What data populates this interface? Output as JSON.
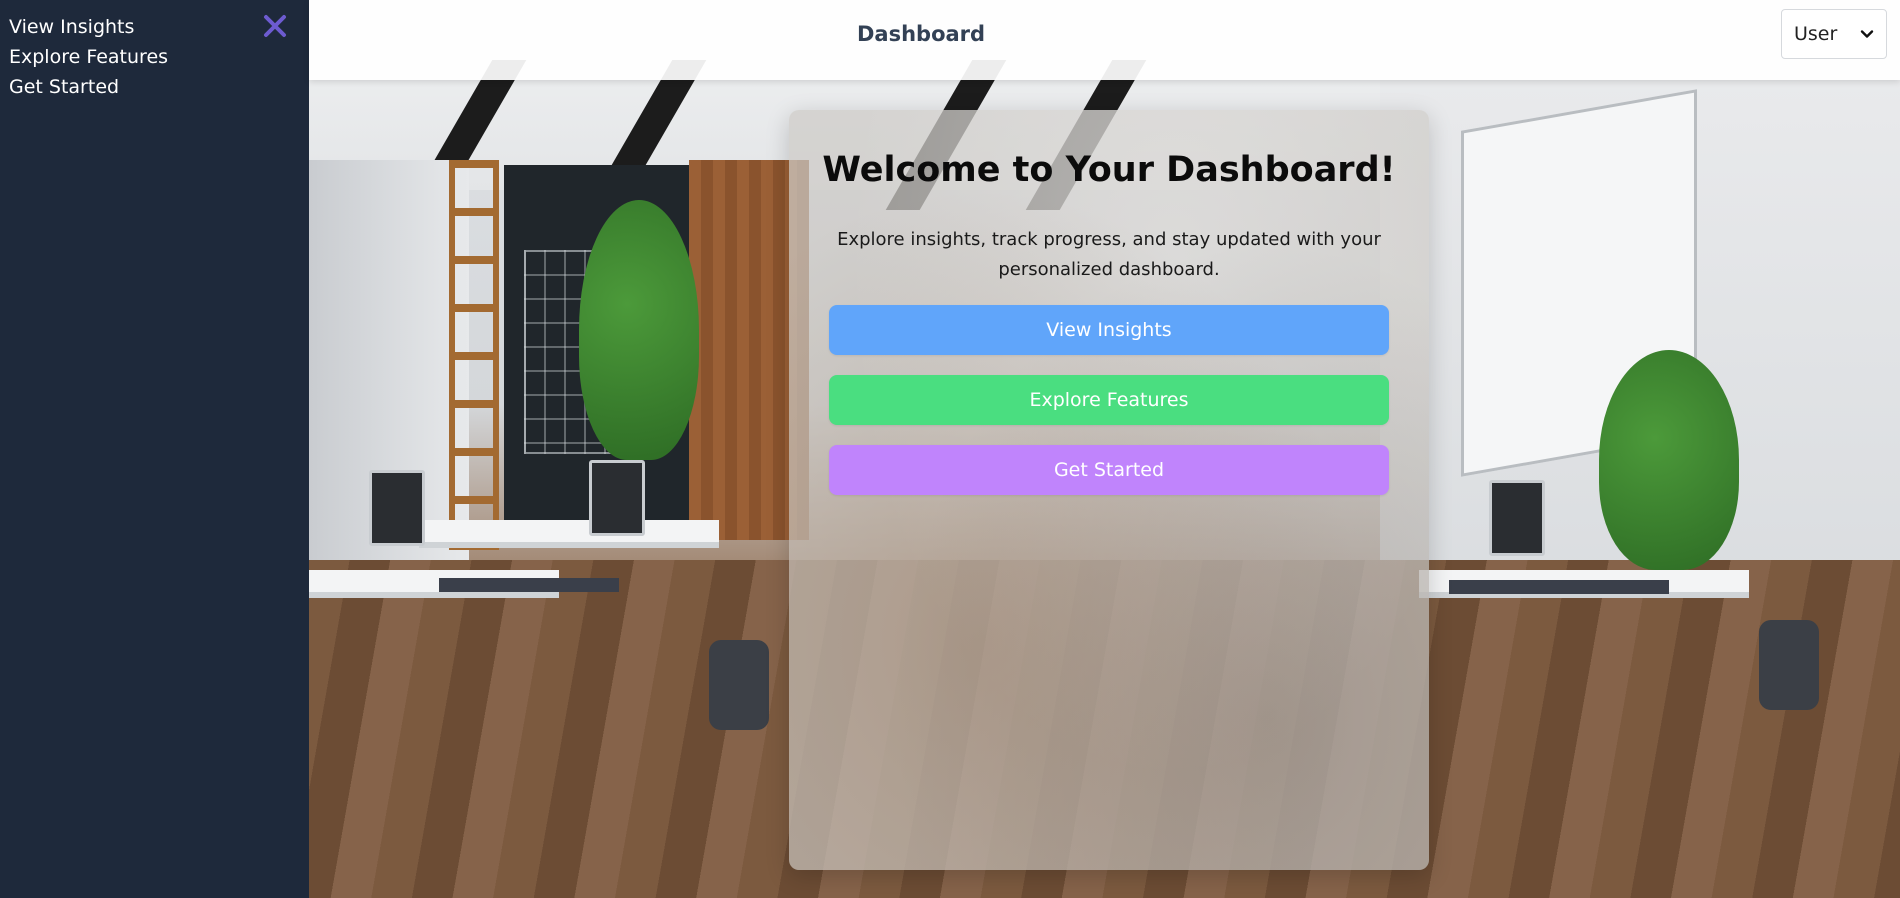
{
  "sidebar": {
    "items": [
      {
        "label": "View Insights"
      },
      {
        "label": "Explore Features"
      },
      {
        "label": "Get Started"
      }
    ],
    "close_icon": "close-x-icon",
    "close_color": "#6d5bd0"
  },
  "header": {
    "title": "Dashboard",
    "user_select": {
      "selected": "User",
      "icon": "chevron-down-icon"
    }
  },
  "card": {
    "title": "Welcome to Your Dashboard!",
    "text": "Explore insights, track progress, and stay updated with your personalized dashboard.",
    "buttons": [
      {
        "label": "View Insights",
        "color": "#60a5fa"
      },
      {
        "label": "Explore Features",
        "color": "#4ade80"
      },
      {
        "label": "Get Started",
        "color": "#c084fc"
      }
    ]
  },
  "colors": {
    "sidebar_bg": "#1e293b",
    "header_title": "#334155"
  }
}
